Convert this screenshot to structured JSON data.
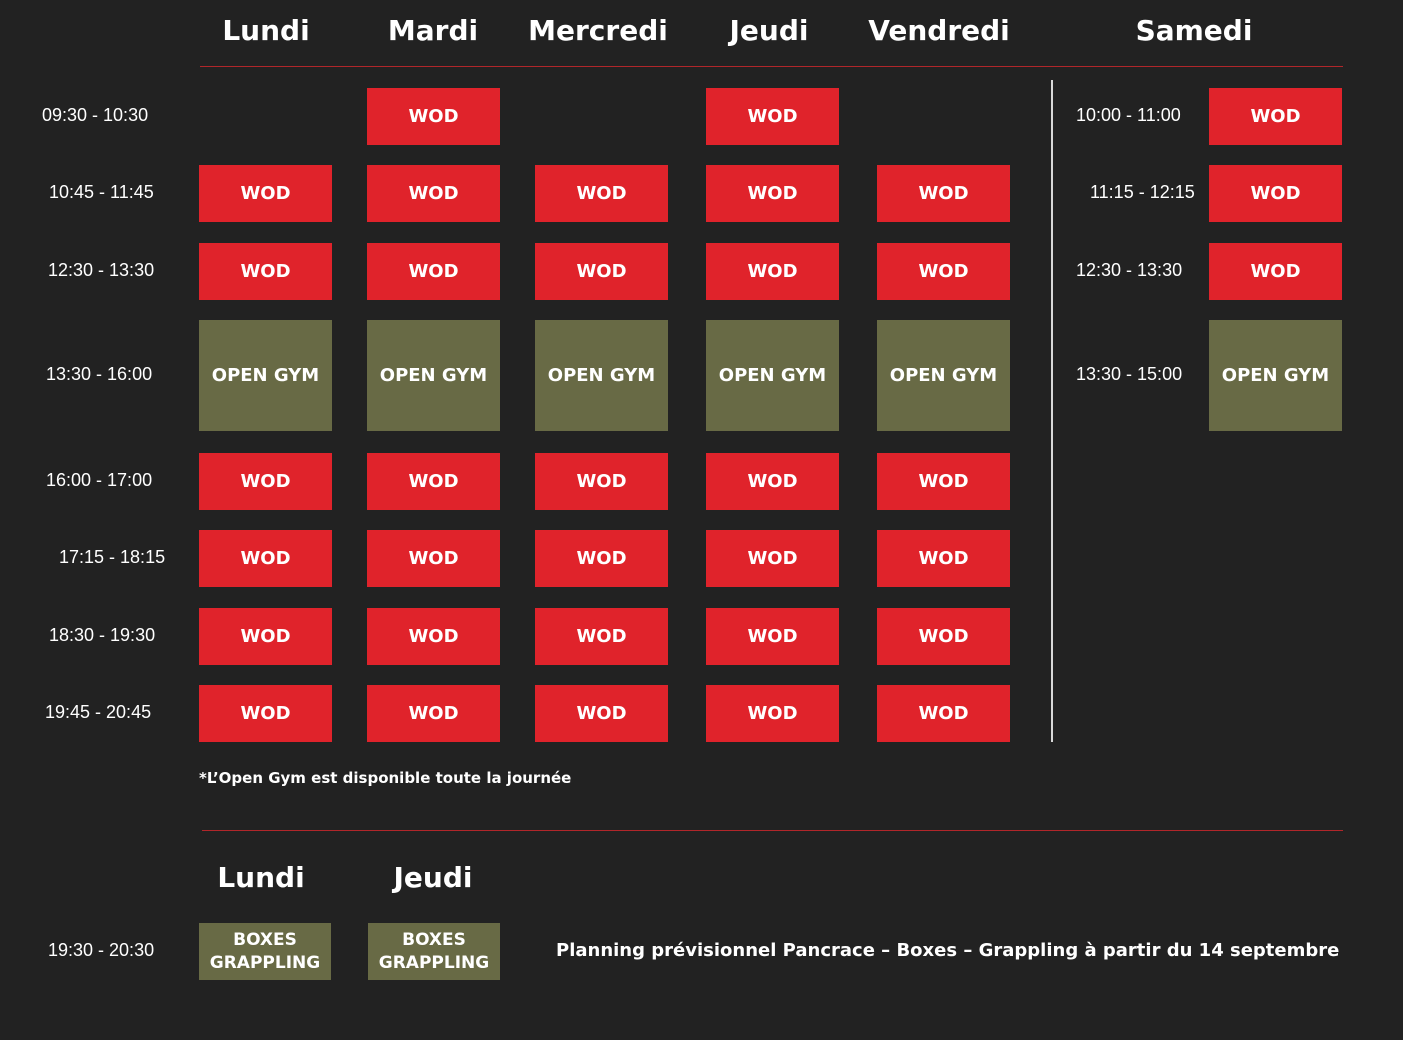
{
  "colors": {
    "wod": "#e0232b",
    "open_gym": "#686a45",
    "rule": "#b1262a",
    "background": "#222222"
  },
  "weekdays": [
    "Lundi",
    "Mardi",
    "Mercredi",
    "Jeudi",
    "Vendredi"
  ],
  "saturday": "Samedi",
  "weekday_times": [
    "09:30 - 10:30",
    "10:45 - 11:45",
    "12:30 - 13:30",
    "13:30 - 16:00",
    "16:00 - 17:00",
    "17:15 - 18:15",
    "18:30 - 19:30",
    "19:45 - 20:45"
  ],
  "weekday_grid": [
    [
      "",
      "WOD",
      "",
      "WOD",
      ""
    ],
    [
      "WOD",
      "WOD",
      "WOD",
      "WOD",
      "WOD"
    ],
    [
      "WOD",
      "WOD",
      "WOD",
      "WOD",
      "WOD"
    ],
    [
      "OPEN GYM",
      "OPEN GYM",
      "OPEN GYM",
      "OPEN GYM",
      "OPEN GYM"
    ],
    [
      "WOD",
      "WOD",
      "WOD",
      "WOD",
      "WOD"
    ],
    [
      "WOD",
      "WOD",
      "WOD",
      "WOD",
      "WOD"
    ],
    [
      "WOD",
      "WOD",
      "WOD",
      "WOD",
      "WOD"
    ],
    [
      "WOD",
      "WOD",
      "WOD",
      "WOD",
      "WOD"
    ]
  ],
  "saturday_rows": [
    {
      "time": "10:00 - 11:00",
      "label": "WOD"
    },
    {
      "time": "11:15 - 12:15",
      "label": "WOD"
    },
    {
      "time": "12:30 - 13:30",
      "label": "WOD"
    },
    {
      "time": "13:30 - 15:00",
      "label": "OPEN GYM"
    }
  ],
  "note": "*L’Open Gym est disponible toute la journée",
  "combat": {
    "days": [
      "Lundi",
      "Jeudi"
    ],
    "time": "19:30 - 20:30",
    "label_line1": "BOXES",
    "label_line2": "GRAPPLING",
    "planning_text": "Planning prévisionnel Pancrace – Boxes – Grappling à partir du 14 septembre"
  }
}
